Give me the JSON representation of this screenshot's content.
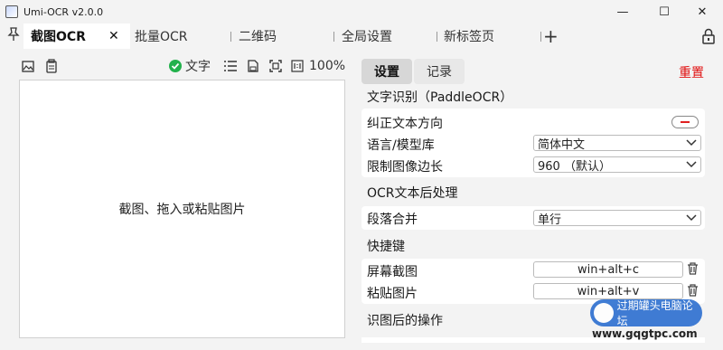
{
  "window": {
    "title": "Umi-OCR v2.0.0",
    "controls": {
      "minimize": "—",
      "maximize": "☐",
      "close": "✕"
    }
  },
  "tabs": {
    "items": [
      {
        "label": "截图OCR",
        "active": true
      },
      {
        "label": "批量OCR"
      },
      {
        "label": "二维码"
      },
      {
        "label": "全局设置"
      },
      {
        "label": "新标签页"
      }
    ],
    "add": "+",
    "close": "✕",
    "pin_icon": "pin-icon",
    "lock_icon": "lock-icon"
  },
  "left": {
    "toolbar": {
      "text_toggle": "文字",
      "zoom": "100%"
    },
    "hint": "截图、拖入或粘贴图片"
  },
  "right": {
    "tabs": [
      "设置",
      "记录"
    ],
    "reset": "重置",
    "sections": {
      "ocr": {
        "title": "文字识别（PaddleOCR）",
        "rows": {
          "correct_dir": {
            "label": "纠正文本方向"
          },
          "lang": {
            "label": "语言/模型库",
            "value": "简体中文"
          },
          "limit": {
            "label": "限制图像边长",
            "value": "960 （默认）"
          }
        }
      },
      "post": {
        "title": "OCR文本后处理",
        "merge": {
          "label": "段落合并",
          "value": "单行"
        }
      },
      "hotkey": {
        "title": "快捷键",
        "screenshot": {
          "label": "屏幕截图",
          "value": "win+alt+c"
        },
        "paste": {
          "label": "粘贴图片",
          "value": "win+alt+v"
        }
      },
      "after": {
        "title": "识图后的操作"
      }
    }
  },
  "watermark": {
    "text": "过期罐头电脑论坛",
    "url": "www.gqgtpc.com"
  },
  "colors": {
    "accent_red": "#e01010",
    "ok_green": "#22b14c"
  }
}
